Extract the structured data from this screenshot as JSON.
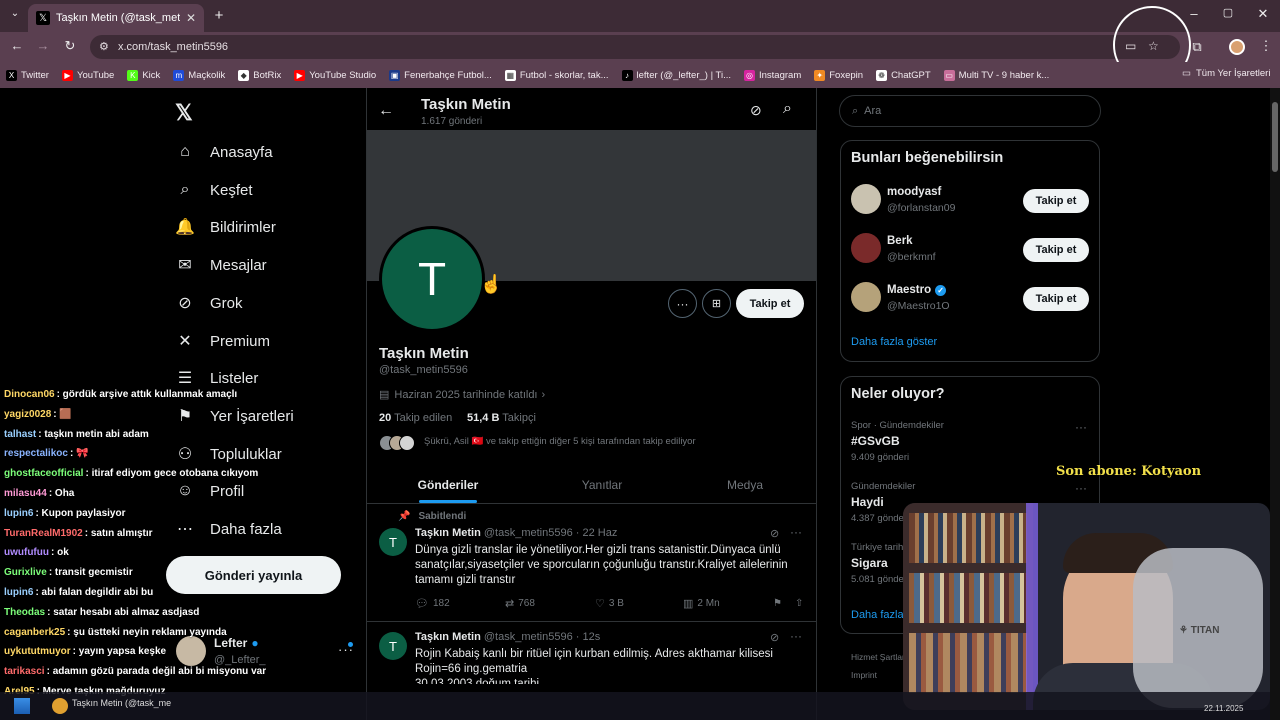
{
  "browser": {
    "tab_title": "Taşkın Metin (@task_metin5596",
    "url": "x.com/task_metin5596",
    "bookmarks": [
      {
        "label": "Twitter",
        "color": "#000000",
        "glyph": "X"
      },
      {
        "label": "YouTube",
        "color": "#ff0000",
        "glyph": "▶"
      },
      {
        "label": "Kick",
        "color": "#53fc18",
        "glyph": "K"
      },
      {
        "label": "Maçkolik",
        "color": "#1f4bd8",
        "glyph": "m"
      },
      {
        "label": "BotRix",
        "color": "#ffffff",
        "glyph": "◆"
      },
      {
        "label": "YouTube Studio",
        "color": "#ff0000",
        "glyph": "▶"
      },
      {
        "label": "Fenerbahçe Futbol...",
        "color": "#1b3a8a",
        "glyph": "▣"
      },
      {
        "label": "Futbol - skorlar, tak...",
        "color": "#ffffff",
        "glyph": "▦"
      },
      {
        "label": "lefter (@_lefter_) | Ti...",
        "color": "#000000",
        "glyph": "♪"
      },
      {
        "label": "Instagram",
        "color": "#d6249f",
        "glyph": "◎"
      },
      {
        "label": "Foxepin",
        "color": "#f08a24",
        "glyph": "✦"
      },
      {
        "label": "ChatGPT",
        "color": "#ffffff",
        "glyph": "❁"
      },
      {
        "label": "Multi TV - 9 haber k...",
        "color": "#c86e9a",
        "glyph": "▭"
      }
    ],
    "all_bookmarks": "Tüm Yer İşaretleri"
  },
  "sidebar": {
    "items": [
      {
        "label": "Anasayfa",
        "icon": "home-icon",
        "glyph": "⌂"
      },
      {
        "label": "Keşfet",
        "icon": "search-icon",
        "glyph": "⌕"
      },
      {
        "label": "Bildirimler",
        "icon": "bell-icon",
        "glyph": "🔔"
      },
      {
        "label": "Mesajlar",
        "icon": "mail-icon",
        "glyph": "✉"
      },
      {
        "label": "Grok",
        "icon": "grok-icon",
        "glyph": "⊘"
      },
      {
        "label": "Premium",
        "icon": "x-logo-icon",
        "glyph": "✕"
      },
      {
        "label": "Listeler",
        "icon": "list-icon",
        "glyph": "☰"
      },
      {
        "label": "Yer İşaretleri",
        "icon": "bookmark-icon",
        "glyph": "⚑"
      },
      {
        "label": "Topluluklar",
        "icon": "community-icon",
        "glyph": "⚇"
      },
      {
        "label": "Profil",
        "icon": "profile-icon",
        "glyph": "☺"
      },
      {
        "label": "Daha fazla",
        "icon": "more-circle-icon",
        "glyph": "⋯"
      }
    ],
    "post_button": "Gönderi yayınla",
    "account_name": "Lefter",
    "account_handle": "@_Lefter_"
  },
  "profile": {
    "header_name": "Taşkın Metin",
    "header_count": "1.617 gönderi",
    "avatar_letter": "T",
    "name": "Taşkın Metin",
    "handle": "@task_metin5596",
    "joined": "Haziran 2025 tarihinde katıldı",
    "following_count": "20",
    "following_label": "Takip edilen",
    "followers_count": "51,4 B",
    "followers_label": "Takipçi",
    "followed_by": "Şükrü, Asil 🇹🇷 ve takip ettiğin diğer 5 kişi tarafından takip ediliyor",
    "follow_button": "Takip et",
    "tabs": [
      "Gönderiler",
      "Yanıtlar",
      "Medya"
    ]
  },
  "posts": [
    {
      "pinned": "Sabitlendi",
      "name": "Taşkın Metin",
      "meta": "@task_metin5596 · 22 Haz",
      "text": [
        "Dünya gizli translar ile yönetiliyor.Her gizli trans satanisttir.Dünyaca ünlü",
        "sanatçılar,siyasetçiler ve sporcuların çoğunluğu transtır.Kraliyet ailelerinin",
        "tamamı gizli transtır"
      ],
      "replies": "182",
      "reposts": "768",
      "likes": "3 B",
      "views": "2 Mn"
    },
    {
      "name": "Taşkın Metin",
      "meta": "@task_metin5596 · 12s",
      "text": [
        "Rojin Kabaiş kanlı bir ritüel için kurban edilmiş. Adres akthamar kilisesi",
        "Rojin=66 ing.gematria",
        "30.03.2003 doğum tarihi"
      ]
    }
  ],
  "right": {
    "search_placeholder": "Ara",
    "suggest_title": "Bunları beğenebilirsin",
    "suggestions": [
      {
        "name": "moodyasf",
        "handle": "@forlanstan09",
        "verified": false,
        "btn": "Takip et"
      },
      {
        "name": "Berk",
        "handle": "@berkmnf",
        "verified": false,
        "btn": "Takip et"
      },
      {
        "name": "Maestro",
        "handle": "@Maestro1O",
        "verified": true,
        "btn": "Takip et"
      }
    ],
    "show_more": "Daha fazla göster",
    "trends_title": "Neler oluyor?",
    "trends": [
      {
        "category": "Spor · Gündemdekiler",
        "topic": "#GSvGB",
        "count": "9.409 gönderi"
      },
      {
        "category": "Gündemdekiler",
        "topic": "Haydi",
        "count": "4.387 gönderi"
      },
      {
        "category": "Türkiye tarihinde",
        "topic": "Sigara",
        "count": "5.081 gönderi"
      }
    ],
    "trends_more": "Daha fazla",
    "footer1": "Hizmet Şartları",
    "footer2": "Imprint"
  },
  "overlay": {
    "sub_label": "Son abone: Kotyaon",
    "chat": [
      {
        "user": "Dinocan06",
        "color": "#ffd866",
        "msg": ": gördük arşive attık kullanmak amaçlı"
      },
      {
        "user": "yagiz0028",
        "color": "#ffd866",
        "msg": ": 🟫"
      },
      {
        "user": "talhast",
        "color": "#9ad0ff",
        "msg": ": taşkın metin abi adam"
      },
      {
        "user": "respectalikoc",
        "color": "#8ab4ff",
        "msg": ": 🎀"
      },
      {
        "user": "ghostfaceofficial",
        "color": "#7dff7a",
        "msg": ": itiraf ediyom gece otobana cıkıyom"
      },
      {
        "user": "milasu44",
        "color": "#ff9ad5",
        "msg": ": Oha"
      },
      {
        "user": "lupin6",
        "color": "#9ad0ff",
        "msg": ": Kupon paylasiyor"
      },
      {
        "user": "TuranRealM1902",
        "color": "#ff6b6b",
        "msg": ": satın almıştır"
      },
      {
        "user": "uwufufuu",
        "color": "#b18cff",
        "msg": ": ok"
      },
      {
        "user": "Gurixlive",
        "color": "#7dff7a",
        "msg": ": transit gecmistir"
      },
      {
        "user": "lupin6",
        "color": "#9ad0ff",
        "msg": ": abi falan degildir abi bu"
      },
      {
        "user": "Theodas",
        "color": "#7dff7a",
        "msg": ": satar hesabı abi almaz asdjasd"
      },
      {
        "user": "caganberk25",
        "color": "#ffd866",
        "msg": ": şu üstteki neyin reklamı yayında"
      },
      {
        "user": "uykututmuyor",
        "color": "#ffd866",
        "msg": ": yayın yapsa keşke"
      },
      {
        "user": "tarikasci",
        "color": "#ff6b6b",
        "msg": ": adamın gözü parada değil abi bi misyonu var"
      },
      {
        "user": "Arel95",
        "color": "#ffd866",
        "msg": ": Merve taşkın mağduruyuz"
      }
    ],
    "taskbar_item": "Taşkın Metin (@task_me",
    "clock": "22.11.2025"
  },
  "colors": {
    "avatar_bg": "#0b5e44",
    "verified": "#1d9bf0",
    "accent": "#1d9bf0"
  }
}
